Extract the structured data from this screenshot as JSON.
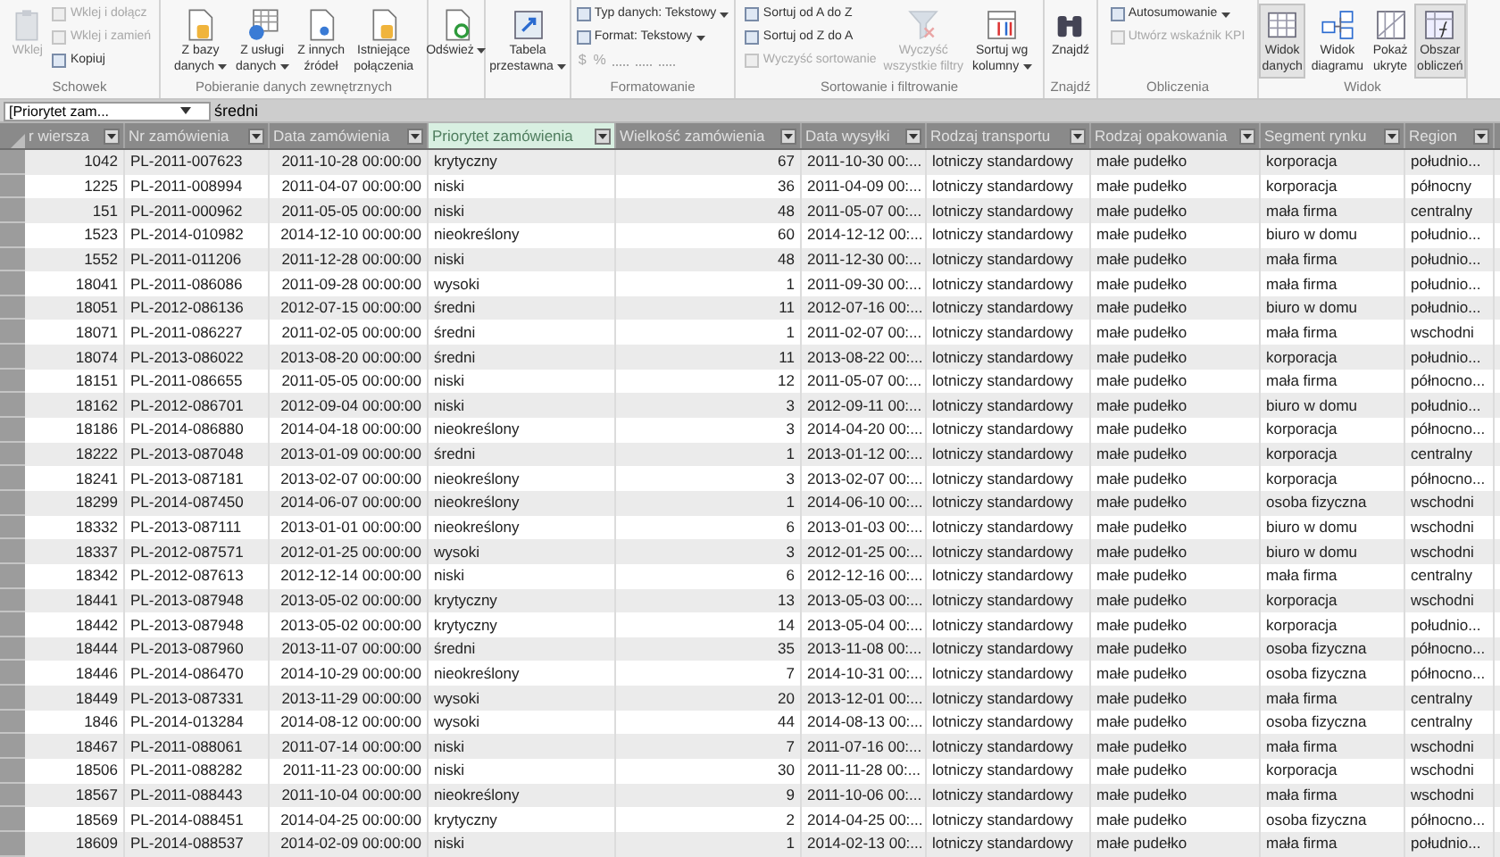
{
  "ribbon": {
    "groups": [
      {
        "label": "Schowek",
        "items": [
          {
            "kind": "large",
            "label": "Wklej",
            "disabled": true,
            "dropdown": false
          },
          {
            "kind": "small",
            "label": "Wklej i dołącz",
            "disabled": true,
            "dropdown": false
          },
          {
            "kind": "small",
            "label": "Wklej i zamień",
            "disabled": true,
            "dropdown": false
          },
          {
            "kind": "small",
            "label": "Kopiuj",
            "disabled": false,
            "dropdown": false
          }
        ]
      },
      {
        "label": "Pobieranie danych zewnętrznych",
        "items": [
          {
            "kind": "large",
            "label": "Z bazy\ndanych",
            "disabled": false,
            "dropdown": true
          },
          {
            "kind": "large",
            "label": "Z usługi\ndanych",
            "disabled": false,
            "dropdown": true
          },
          {
            "kind": "large",
            "label": "Z innych\nźródeł",
            "disabled": false,
            "dropdown": false
          },
          {
            "kind": "large",
            "label": "Istniejące\npołączenia",
            "disabled": false,
            "dropdown": false
          }
        ]
      },
      {
        "items": [
          {
            "kind": "large",
            "label": "Odśwież",
            "disabled": false,
            "dropdown": true
          }
        ]
      },
      {
        "items": [
          {
            "kind": "large",
            "label": "Tabela\nprzestawna",
            "disabled": false,
            "dropdown": true
          }
        ]
      },
      {
        "label": "Formatowanie",
        "items": [
          {
            "kind": "small",
            "label": "Typ danych: Tekstowy",
            "disabled": false,
            "dropdown": true
          },
          {
            "kind": "small",
            "label": "Format: Tekstowy",
            "disabled": false,
            "dropdown": true
          },
          {
            "kind": "symbols",
            "symbols": [
              "$",
              "%"
            ],
            "disabled": true
          }
        ]
      },
      {
        "label": "Sortowanie i filtrowanie",
        "items": [
          {
            "kind": "small",
            "label": "Sortuj od A do Z",
            "disabled": false,
            "dropdown": false
          },
          {
            "kind": "small",
            "label": "Sortuj od Z do A",
            "disabled": false,
            "dropdown": false
          },
          {
            "kind": "small",
            "label": "Wyczyść sortowanie",
            "disabled": true,
            "dropdown": false
          },
          {
            "kind": "large",
            "label": "Wyczyść\nwszystkie filtry",
            "disabled": true,
            "dropdown": false
          },
          {
            "kind": "large",
            "label": "Sortuj wg\nkolumny",
            "disabled": false,
            "dropdown": true
          }
        ]
      },
      {
        "label": "Znajdź",
        "items": [
          {
            "kind": "large",
            "label": "Znajdź",
            "disabled": false,
            "dropdown": false
          }
        ]
      },
      {
        "label": "Obliczenia",
        "items": [
          {
            "kind": "small",
            "label": "Autosumowanie",
            "disabled": false,
            "dropdown": true
          },
          {
            "kind": "small",
            "label": "Utwórz wskaźnik KPI",
            "disabled": true,
            "dropdown": false
          }
        ]
      },
      {
        "label": "Widok",
        "items": [
          {
            "kind": "large",
            "label": "Widok\ndanych",
            "disabled": false,
            "dropdown": false,
            "selected": true
          },
          {
            "kind": "large",
            "label": "Widok\ndiagramu",
            "disabled": false,
            "dropdown": false,
            "selected": false
          },
          {
            "kind": "large",
            "label": "Pokaż\nukryte",
            "disabled": false,
            "dropdown": false,
            "selected": false
          },
          {
            "kind": "large",
            "label": "Obszar\nobliczeń",
            "disabled": false,
            "dropdown": false,
            "selected": true
          }
        ]
      }
    ]
  },
  "formula_bar": {
    "name_box": "[Priorytet zam...",
    "value": "średni"
  },
  "table": {
    "columns": [
      {
        "label": "r wiersza",
        "selected": false
      },
      {
        "label": "Nr zamówienia",
        "selected": false
      },
      {
        "label": "Data zamówienia",
        "selected": false
      },
      {
        "label": "Priorytet zamówienia",
        "selected": true
      },
      {
        "label": "Wielkość zamówienia",
        "selected": false
      },
      {
        "label": "Data wysyłki",
        "selected": false
      },
      {
        "label": "Rodzaj transportu",
        "selected": false
      },
      {
        "label": "Rodzaj opakowania",
        "selected": false
      },
      {
        "label": "Segment rynku",
        "selected": false
      },
      {
        "label": "Region",
        "selected": false
      }
    ],
    "rows": [
      [
        "1042",
        "PL-2011-007623",
        "2011-10-28 00:00:00",
        "krytyczny",
        "67",
        "2011-10-30 00:...",
        "lotniczy standardowy",
        "małe pudełko",
        "korporacja",
        "południo..."
      ],
      [
        "1225",
        "PL-2011-008994",
        "2011-04-07 00:00:00",
        "niski",
        "36",
        "2011-04-09 00:...",
        "lotniczy standardowy",
        "małe pudełko",
        "korporacja",
        "północny"
      ],
      [
        "151",
        "PL-2011-000962",
        "2011-05-05 00:00:00",
        "niski",
        "48",
        "2011-05-07 00:...",
        "lotniczy standardowy",
        "małe pudełko",
        "mała firma",
        "centralny"
      ],
      [
        "1523",
        "PL-2014-010982",
        "2014-12-10 00:00:00",
        "nieokreślony",
        "60",
        "2014-12-12 00:...",
        "lotniczy standardowy",
        "małe pudełko",
        "biuro w domu",
        "południo..."
      ],
      [
        "1552",
        "PL-2011-011206",
        "2011-12-28 00:00:00",
        "niski",
        "48",
        "2011-12-30 00:...",
        "lotniczy standardowy",
        "małe pudełko",
        "mała firma",
        "południo..."
      ],
      [
        "18041",
        "PL-2011-086086",
        "2011-09-28 00:00:00",
        "wysoki",
        "1",
        "2011-09-30 00:...",
        "lotniczy standardowy",
        "małe pudełko",
        "mała firma",
        "południo..."
      ],
      [
        "18051",
        "PL-2012-086136",
        "2012-07-15 00:00:00",
        "średni",
        "11",
        "2012-07-16 00:...",
        "lotniczy standardowy",
        "małe pudełko",
        "biuro w domu",
        "południo..."
      ],
      [
        "18071",
        "PL-2011-086227",
        "2011-02-05 00:00:00",
        "średni",
        "1",
        "2011-02-07 00:...",
        "lotniczy standardowy",
        "małe pudełko",
        "mała firma",
        "wschodni"
      ],
      [
        "18074",
        "PL-2013-086022",
        "2013-08-20 00:00:00",
        "średni",
        "11",
        "2013-08-22 00:...",
        "lotniczy standardowy",
        "małe pudełko",
        "korporacja",
        "południo..."
      ],
      [
        "18151",
        "PL-2011-086655",
        "2011-05-05 00:00:00",
        "niski",
        "12",
        "2011-05-07 00:...",
        "lotniczy standardowy",
        "małe pudełko",
        "mała firma",
        "północno..."
      ],
      [
        "18162",
        "PL-2012-086701",
        "2012-09-04 00:00:00",
        "niski",
        "3",
        "2012-09-11 00:...",
        "lotniczy standardowy",
        "małe pudełko",
        "biuro w domu",
        "południo..."
      ],
      [
        "18186",
        "PL-2014-086880",
        "2014-04-18 00:00:00",
        "nieokreślony",
        "3",
        "2014-04-20 00:...",
        "lotniczy standardowy",
        "małe pudełko",
        "korporacja",
        "północno..."
      ],
      [
        "18222",
        "PL-2013-087048",
        "2013-01-09 00:00:00",
        "średni",
        "1",
        "2013-01-12 00:...",
        "lotniczy standardowy",
        "małe pudełko",
        "korporacja",
        "centralny"
      ],
      [
        "18241",
        "PL-2013-087181",
        "2013-02-07 00:00:00",
        "nieokreślony",
        "3",
        "2013-02-07 00:...",
        "lotniczy standardowy",
        "małe pudełko",
        "korporacja",
        "północno..."
      ],
      [
        "18299",
        "PL-2014-087450",
        "2014-06-07 00:00:00",
        "nieokreślony",
        "1",
        "2014-06-10 00:...",
        "lotniczy standardowy",
        "małe pudełko",
        "osoba fizyczna",
        "wschodni"
      ],
      [
        "18332",
        "PL-2013-087111",
        "2013-01-01 00:00:00",
        "nieokreślony",
        "6",
        "2013-01-03 00:...",
        "lotniczy standardowy",
        "małe pudełko",
        "biuro w domu",
        "wschodni"
      ],
      [
        "18337",
        "PL-2012-087571",
        "2012-01-25 00:00:00",
        "wysoki",
        "3",
        "2012-01-25 00:...",
        "lotniczy standardowy",
        "małe pudełko",
        "biuro w domu",
        "wschodni"
      ],
      [
        "18342",
        "PL-2012-087613",
        "2012-12-14 00:00:00",
        "niski",
        "6",
        "2012-12-16 00:...",
        "lotniczy standardowy",
        "małe pudełko",
        "mała firma",
        "centralny"
      ],
      [
        "18441",
        "PL-2013-087948",
        "2013-05-02 00:00:00",
        "krytyczny",
        "13",
        "2013-05-03 00:...",
        "lotniczy standardowy",
        "małe pudełko",
        "korporacja",
        "wschodni"
      ],
      [
        "18442",
        "PL-2013-087948",
        "2013-05-02 00:00:00",
        "krytyczny",
        "14",
        "2013-05-04 00:...",
        "lotniczy standardowy",
        "małe pudełko",
        "korporacja",
        "południo..."
      ],
      [
        "18444",
        "PL-2013-087960",
        "2013-11-07 00:00:00",
        "średni",
        "35",
        "2013-11-08 00:...",
        "lotniczy standardowy",
        "małe pudełko",
        "osoba fizyczna",
        "północno..."
      ],
      [
        "18446",
        "PL-2014-086470",
        "2014-10-29 00:00:00",
        "nieokreślony",
        "7",
        "2014-10-31 00:...",
        "lotniczy standardowy",
        "małe pudełko",
        "osoba fizyczna",
        "północno..."
      ],
      [
        "18449",
        "PL-2013-087331",
        "2013-11-29 00:00:00",
        "wysoki",
        "20",
        "2013-12-01 00:...",
        "lotniczy standardowy",
        "małe pudełko",
        "mała firma",
        "centralny"
      ],
      [
        "1846",
        "PL-2014-013284",
        "2014-08-12 00:00:00",
        "wysoki",
        "44",
        "2014-08-13 00:...",
        "lotniczy standardowy",
        "małe pudełko",
        "osoba fizyczna",
        "centralny"
      ],
      [
        "18467",
        "PL-2011-088061",
        "2011-07-14 00:00:00",
        "niski",
        "7",
        "2011-07-16 00:...",
        "lotniczy standardowy",
        "małe pudełko",
        "mała firma",
        "wschodni"
      ],
      [
        "18506",
        "PL-2011-088282",
        "2011-11-23 00:00:00",
        "niski",
        "30",
        "2011-11-28 00:...",
        "lotniczy standardowy",
        "małe pudełko",
        "korporacja",
        "wschodni"
      ],
      [
        "18567",
        "PL-2011-088443",
        "2011-10-04 00:00:00",
        "nieokreślony",
        "9",
        "2011-10-06 00:...",
        "lotniczy standardowy",
        "małe pudełko",
        "mała firma",
        "wschodni"
      ],
      [
        "18569",
        "PL-2014-088451",
        "2014-04-25 00:00:00",
        "krytyczny",
        "2",
        "2014-04-25 00:...",
        "lotniczy standardowy",
        "małe pudełko",
        "osoba fizyczna",
        "północno..."
      ],
      [
        "18609",
        "PL-2014-088537",
        "2014-02-09 00:00:00",
        "niski",
        "1",
        "2014-02-13 00:...",
        "lotniczy standardowy",
        "małe pudełko",
        "mała firma",
        "południo..."
      ]
    ]
  }
}
